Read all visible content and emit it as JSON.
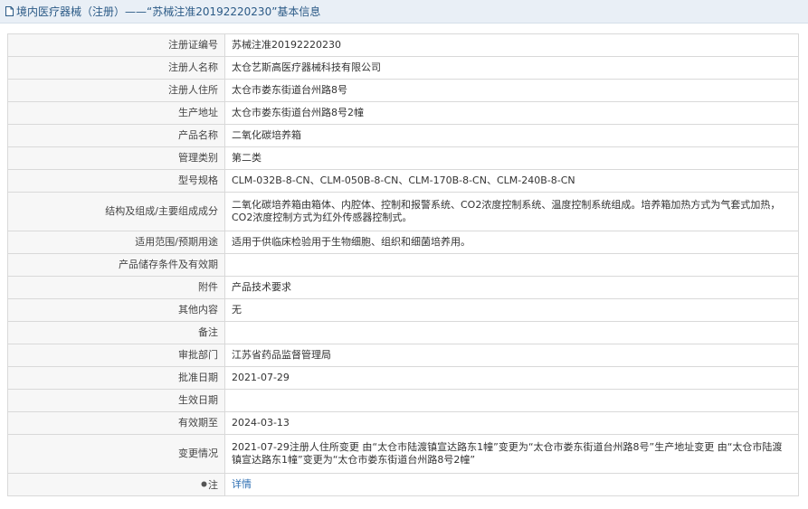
{
  "header": {
    "title": "境内医疗器械（注册）——“苏械注准20192220230”基本信息"
  },
  "rows": [
    {
      "label": "注册证编号",
      "value": "苏械注准20192220230"
    },
    {
      "label": "注册人名称",
      "value": "太仓艺斯高医疗器械科技有限公司"
    },
    {
      "label": "注册人住所",
      "value": "太仓市娄东街道台州路8号"
    },
    {
      "label": "生产地址",
      "value": "太仓市娄东街道台州路8号2幢"
    },
    {
      "label": "产品名称",
      "value": "二氧化碳培养箱"
    },
    {
      "label": "管理类别",
      "value": "第二类"
    },
    {
      "label": "型号规格",
      "value": "CLM-032B-8-CN、CLM-050B-8-CN、CLM-170B-8-CN、CLM-240B-8-CN"
    },
    {
      "label": "结构及组成/主要组成成分",
      "value": "二氧化碳培养箱由箱体、内腔体、控制和报警系统、CO2浓度控制系统、温度控制系统组成。培养箱加热方式为气套式加热，CO2浓度控制方式为红外传感器控制式。"
    },
    {
      "label": "适用范围/预期用途",
      "value": "适用于供临床检验用于生物细胞、组织和细菌培养用。"
    },
    {
      "label": "产品储存条件及有效期",
      "value": ""
    },
    {
      "label": "附件",
      "value": "产品技术要求"
    },
    {
      "label": "其他内容",
      "value": "无"
    },
    {
      "label": "备注",
      "value": ""
    },
    {
      "label": "审批部门",
      "value": "江苏省药品监督管理局"
    },
    {
      "label": "批准日期",
      "value": "2021-07-29"
    },
    {
      "label": "生效日期",
      "value": ""
    },
    {
      "label": "有效期至",
      "value": "2024-03-13"
    },
    {
      "label": "变更情况",
      "value": "2021-07-29注册人住所变更 由“太仓市陆渡镇宣达路东1幢”变更为“太仓市娄东街道台州路8号”生产地址变更 由“太仓市陆渡镇宣达路东1幢”变更为“太仓市娄东街道台州路8号2幢”"
    }
  ],
  "note": {
    "label": "注",
    "link_text": "详情"
  },
  "colors": {
    "header_bg": "#e9eff6",
    "header_text": "#2b5a86",
    "label_bg": "#f7f7f7",
    "border": "#d9d9d9",
    "link": "#2e6fb3"
  }
}
